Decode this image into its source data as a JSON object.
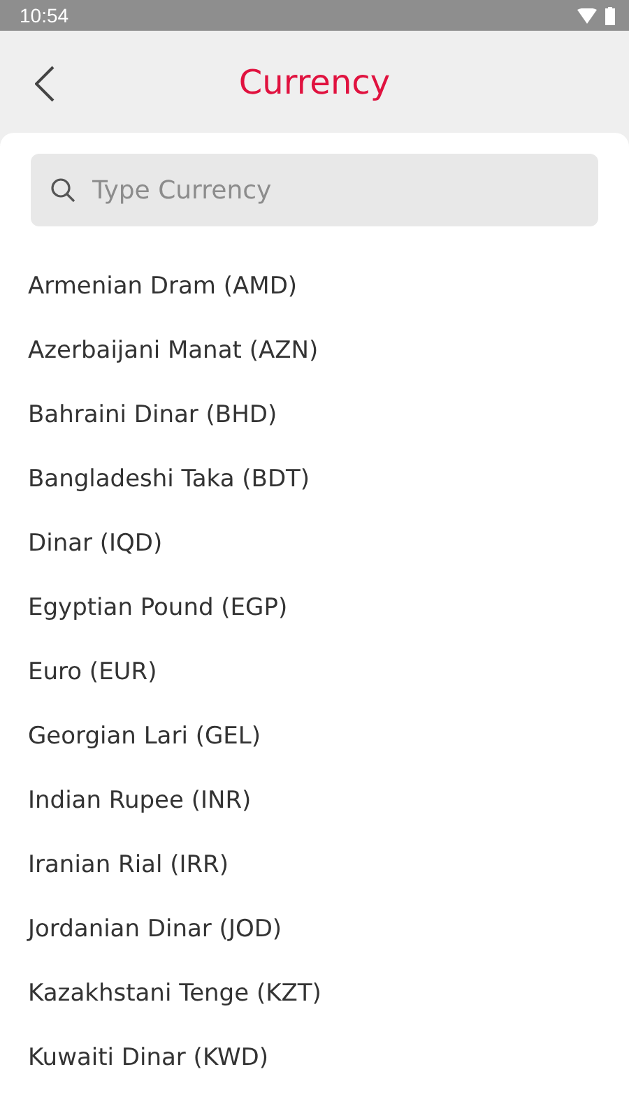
{
  "status_bar": {
    "time": "10:54"
  },
  "header": {
    "title": "Currency"
  },
  "search": {
    "placeholder": "Type Currency"
  },
  "currencies": [
    {
      "label": "Armenian Dram (AMD)"
    },
    {
      "label": "Azerbaijani Manat (AZN)"
    },
    {
      "label": "Bahraini Dinar (BHD)"
    },
    {
      "label": "Bangladeshi Taka (BDT)"
    },
    {
      "label": "Dinar (IQD)"
    },
    {
      "label": "Egyptian Pound (EGP)"
    },
    {
      "label": "Euro (EUR)"
    },
    {
      "label": "Georgian Lari (GEL)"
    },
    {
      "label": "Indian Rupee (INR)"
    },
    {
      "label": "Iranian Rial (IRR)"
    },
    {
      "label": "Jordanian Dinar (JOD)"
    },
    {
      "label": "Kazakhstani Tenge (KZT)"
    },
    {
      "label": "Kuwaiti Dinar (KWD)"
    }
  ]
}
